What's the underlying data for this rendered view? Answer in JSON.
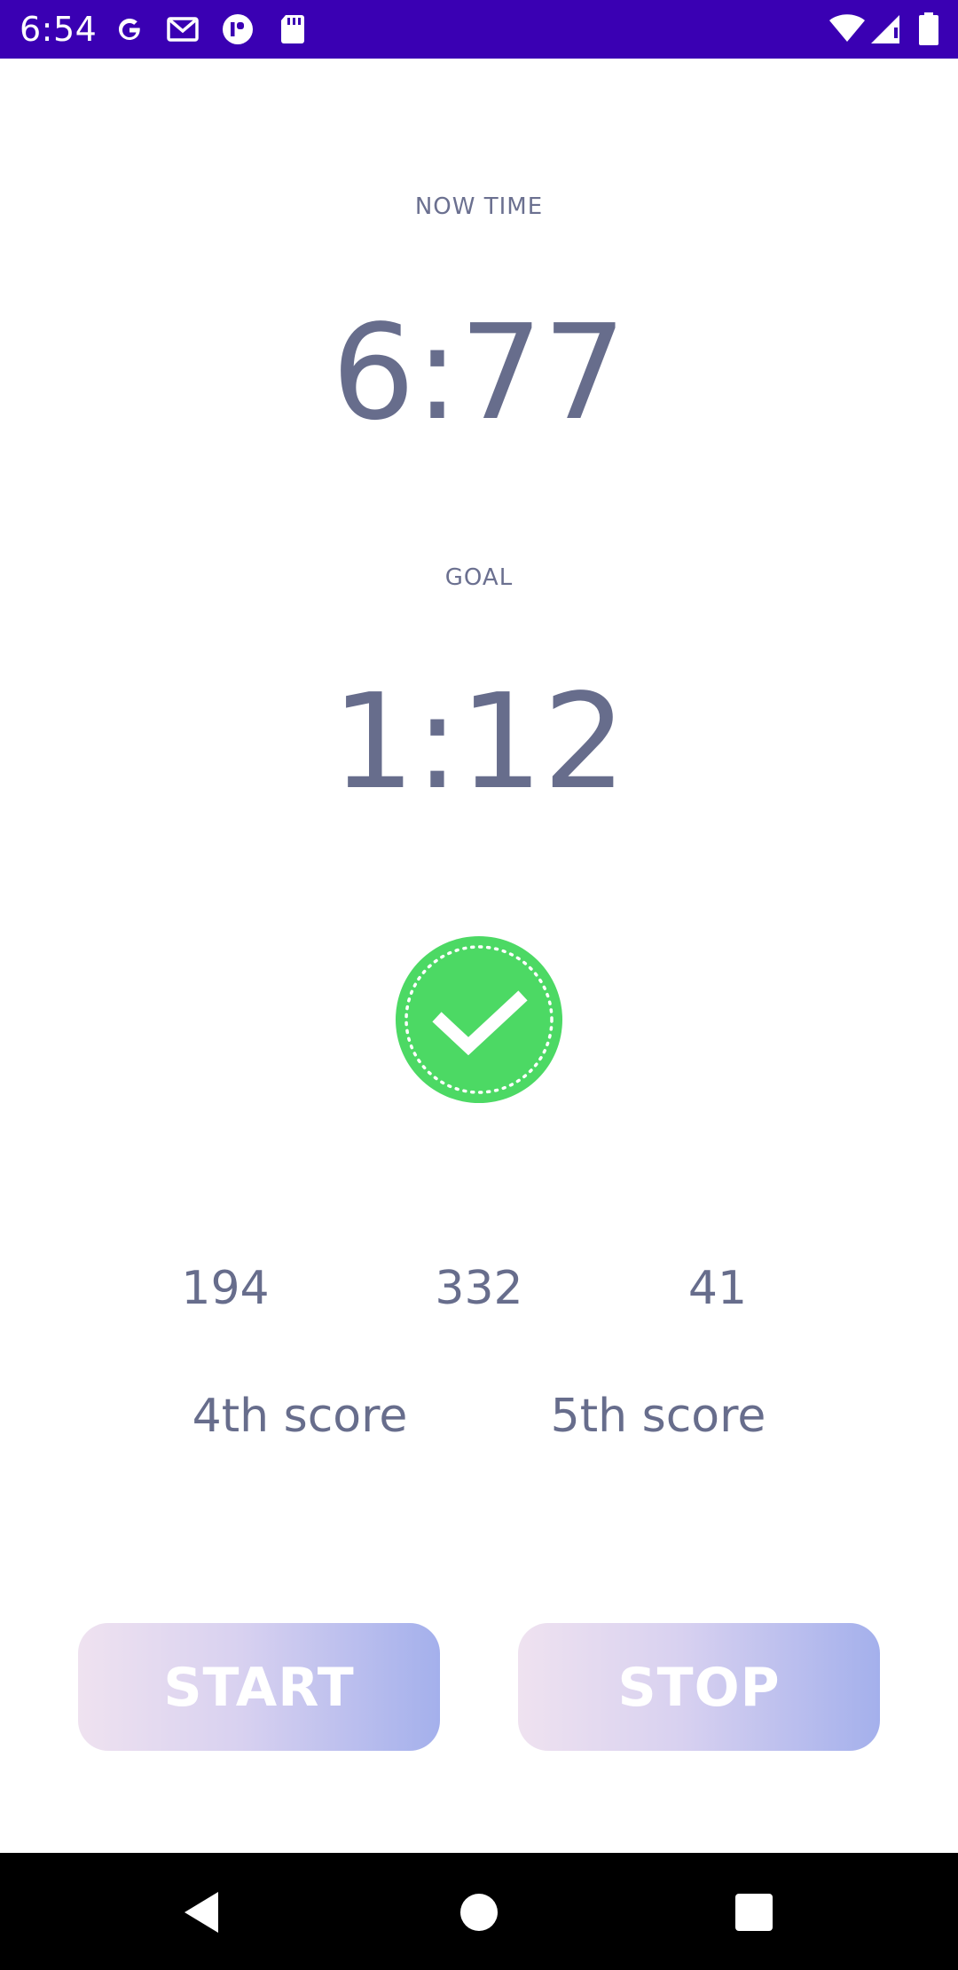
{
  "status_bar": {
    "time": "6:54",
    "left_icons": [
      "google-icon",
      "gmail-icon",
      "app-icon",
      "sd-card-icon"
    ],
    "right_icons": [
      "wifi-icon",
      "cell-signal-icon",
      "battery-icon"
    ],
    "background": "#3a00b3"
  },
  "now_time": {
    "label": "NOW TIME",
    "value": "6:77"
  },
  "goal": {
    "label": "GOAL",
    "value": "1:12"
  },
  "status_indicator": {
    "icon": "check-circle-icon",
    "color": "#4cd964"
  },
  "scores": {
    "values": [
      "194",
      "332",
      "41"
    ],
    "labels": [
      "4th score",
      "5th score"
    ]
  },
  "buttons": {
    "start_label": "START",
    "stop_label": "STOP"
  },
  "nav_bar": {
    "icons": [
      "back-icon",
      "home-icon",
      "recents-icon"
    ]
  },
  "colors": {
    "text": "#676d8c",
    "button_gradient_start": "#efe2f0",
    "button_gradient_end": "#a4b0ec"
  }
}
